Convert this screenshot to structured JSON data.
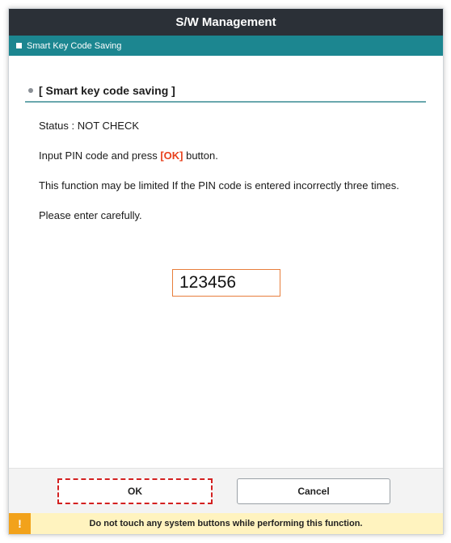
{
  "window": {
    "title": "S/W Management"
  },
  "subheader": {
    "title": "Smart Key Code Saving"
  },
  "section": {
    "title": "[ Smart key code saving ]"
  },
  "content": {
    "status": "Status : NOT CHECK",
    "instruction_before": "Input PIN code and press ",
    "instruction_ok": "[OK]",
    "instruction_after": " button.",
    "limit_notice": "This function may be limited If the PIN code is entered incorrectly three times.",
    "careful": "Please enter carefully."
  },
  "pin_input": {
    "value": "123456"
  },
  "buttons": {
    "ok_label": "OK",
    "cancel_label": "Cancel"
  },
  "warning": {
    "icon": "!",
    "text": "Do not touch any system buttons while performing this function."
  },
  "colors": {
    "titlebar": "#2b3037",
    "subheader": "#1c8690",
    "accent_ok": "#e8401c",
    "input_border": "#e87e3c",
    "warning_bg": "#fff3bf",
    "warning_icon": "#f2a21b"
  }
}
